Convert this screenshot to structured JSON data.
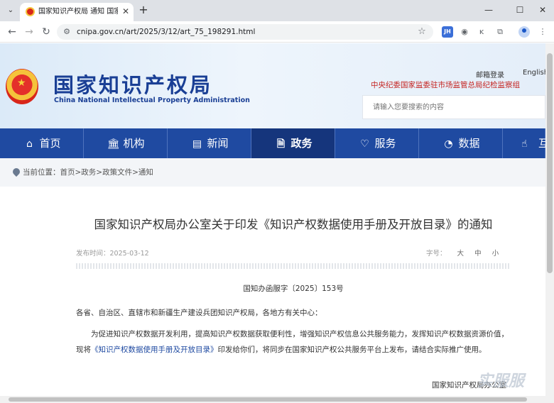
{
  "browser": {
    "tab_title": "国家知识产权局 通知 国家知识产",
    "tab_close": "✕",
    "new_tab": "+",
    "url": "cnipa.gov.cn/art/2025/3/12/art_75_198291.html",
    "ext_badge": "JH"
  },
  "header": {
    "site_name_cn": "国家知识产权局",
    "site_name_en": "China National Intellectual Property Administration",
    "top_links": [
      "邮箱登录",
      "English"
    ],
    "org_line": "中央纪委国家监委驻市场监管总局纪检监察组",
    "search_placeholder": "请输入您要搜索的内容"
  },
  "nav": {
    "items": [
      {
        "label": "首页",
        "icon": "⌂"
      },
      {
        "label": "机构",
        "icon": "🏛"
      },
      {
        "label": "新闻",
        "icon": "▤"
      },
      {
        "label": "政务",
        "icon": "🗎"
      },
      {
        "label": "服务",
        "icon": "♡"
      },
      {
        "label": "数据",
        "icon": "◔"
      },
      {
        "label": "互",
        "icon": "☝"
      }
    ],
    "active_index": 3
  },
  "breadcrumb": "当前位置：首页>政务>政策文件>通知",
  "article": {
    "title": "国家知识产权局办公室关于印发《知识产权数据使用手册及开放目录》的通知",
    "pub_date": "发布时间：2025-03-12",
    "font_label": "字号：",
    "font_options": [
      "大",
      "中",
      "小"
    ],
    "doc_number": "国知办函服字〔2025〕153号",
    "salutation": "各省、自治区、直辖市和新疆生产建设兵团知识产权局，各地方有关中心：",
    "para_part1": "为促进知识产权数据开发利用，提高知识产权数据获取便利性，增强知识产权信息公共服务能力，发挥知识产权数据资源价值，现将",
    "para_link": "《知识产权数据使用手册及开放目录》",
    "para_part2": "印发给你们，将同步在国家知识产权公共服务平台上发布，请结合实际推广使用。",
    "signature": "国家知识产权局办公室",
    "watermark": "实服服"
  },
  "colors": {
    "brand_blue": "#1f4aa1",
    "active_nav": "#15357c",
    "org_red": "#c4221f"
  }
}
